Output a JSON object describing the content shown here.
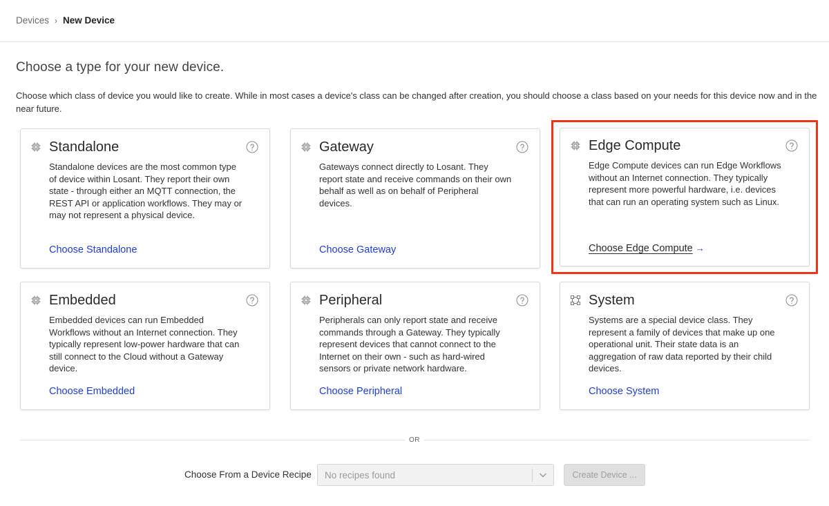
{
  "breadcrumb": {
    "parent": "Devices",
    "separator": "›",
    "current": "New Device"
  },
  "heading": "Choose a type for your new device.",
  "description": "Choose which class of device you would like to create. While in most cases a device's class can be changed after creation, you should choose a class based on your needs for this device now and in the near future.",
  "cards": [
    {
      "title": "Standalone",
      "icon": "chip-icon",
      "body": "Standalone devices are the most common type of device within Losant. They report their own state - through either an MQTT connection, the REST API or application workflows. They may or may not represent a physical device.",
      "link": "Choose Standalone"
    },
    {
      "title": "Gateway",
      "icon": "chip-icon",
      "body": "Gateways connect directly to Losant. They report state and receive commands on their own behalf as well as on behalf of Peripheral devices.",
      "link": "Choose Gateway"
    },
    {
      "title": "Edge Compute",
      "icon": "chip-icon",
      "body": "Edge Compute devices can run Edge Workflows without an Internet connection. They typically represent more powerful hardware, i.e. devices that can run an operating system such as Linux.",
      "link": "Choose Edge Compute",
      "link_arrow": "→"
    },
    {
      "title": "Embedded",
      "icon": "chip-icon",
      "body": "Embedded devices can run Embedded Workflows without an Internet connection. They typically represent low-power hardware that can still connect to the Cloud without a Gateway device.",
      "link": "Choose Embedded"
    },
    {
      "title": "Peripheral",
      "icon": "chip-icon",
      "body": "Peripherals can only report state and receive commands through a Gateway. They typically represent devices that cannot connect to the Internet on their own - such as hard-wired sensors or private network hardware.",
      "link": "Choose Peripheral"
    },
    {
      "title": "System",
      "icon": "system-nodes-icon",
      "body": "Systems are a special device class. They represent a family of devices that make up one operational unit. Their state data is an aggregation of raw data reported by their child devices.",
      "link": "Choose System"
    }
  ],
  "divider_text": "OR",
  "recipe": {
    "label": "Choose From a Device Recipe",
    "placeholder": "No recipes found",
    "create_button": "Create Device ..."
  },
  "colors": {
    "link": "#1f3fd1",
    "highlight": "#f03418",
    "border": "#d9d9d9"
  }
}
